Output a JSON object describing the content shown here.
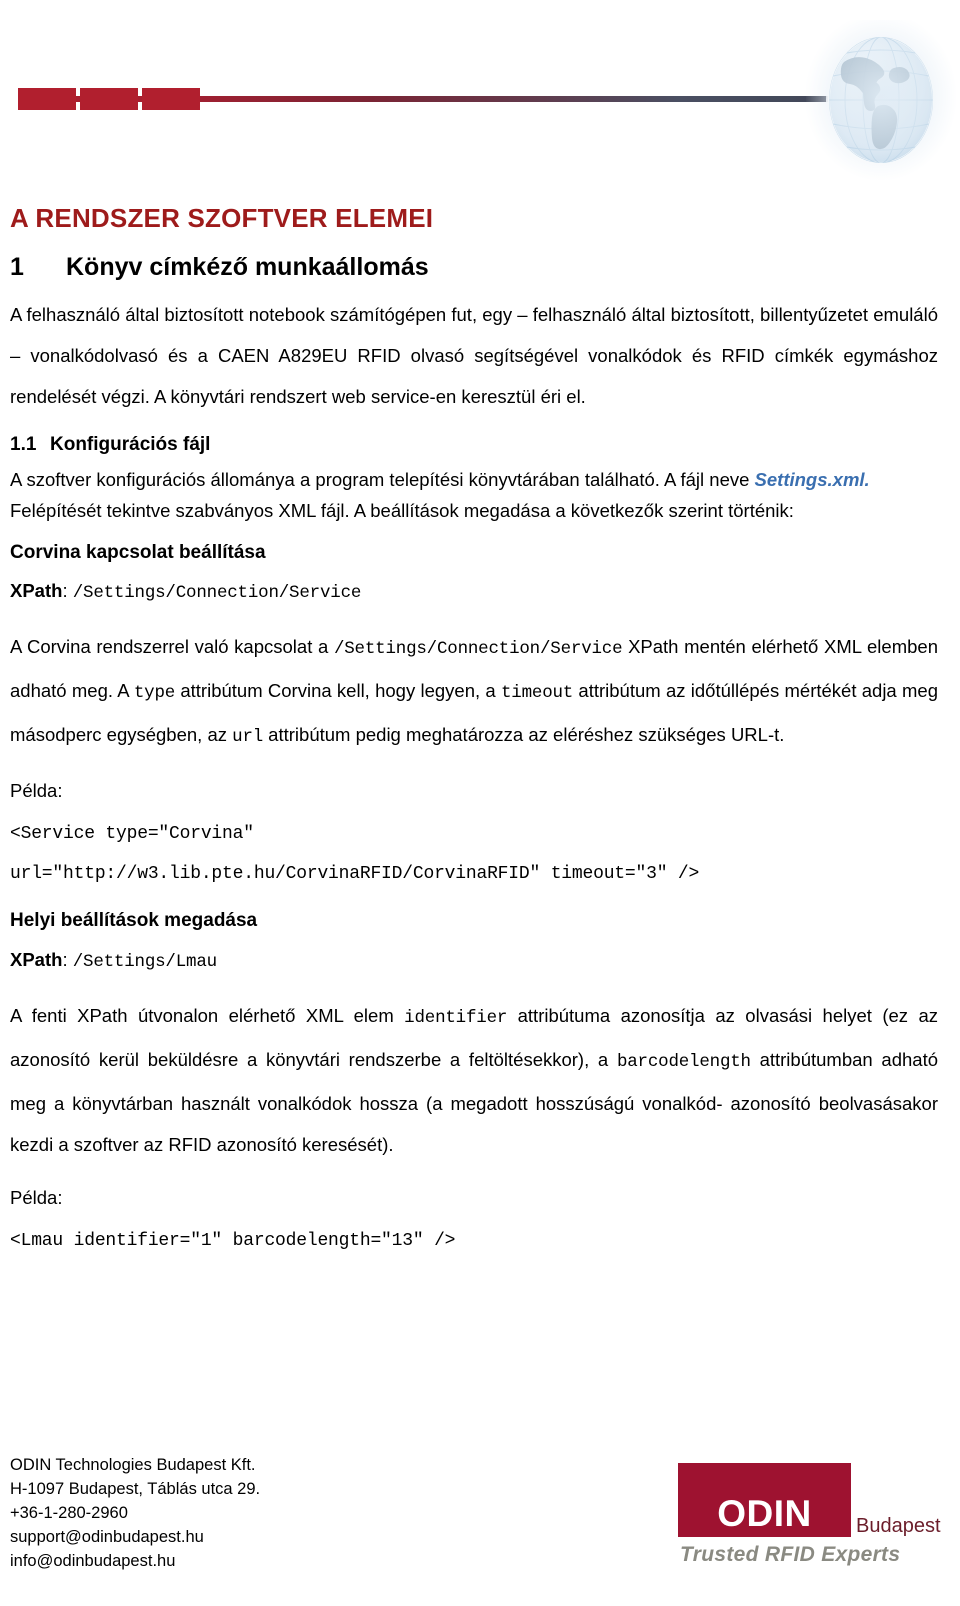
{
  "header": {
    "decor": {
      "bar_color": "#b11f2e",
      "rule_gradient_from": "#a81f30",
      "rule_gradient_to": "#3d4352"
    },
    "globe_alt": "globe-logo"
  },
  "document": {
    "title": "A RENDSZER SZOFTVER ELEMEI",
    "title_color": "#9e1b1b",
    "sections": [
      {
        "number": "1",
        "heading": "Könyv címkéző munkaállomás",
        "paragraph": "A felhasználó által biztosított notebook számítógépen fut, egy – felhasználó által biztosított, billentyűzetet emuláló – vonalkódolvasó és a CAEN A829EU RFID olvasó segítségével vonalkódok és RFID címkék egymáshoz rendelését végzi. A könyvtári rendszert web service-en keresztül éri el."
      }
    ],
    "subsection": {
      "number": "1.1",
      "heading": "Konfigurációs fájl",
      "intro_part1": "A szoftver konfigurációs állománya a program telepítési könyvtárában található. A fájl neve ",
      "intro_filename": "Settings.xml.",
      "intro_filename_color": "#3a6fb0",
      "intro_part2": " Felépítését tekintve szabványos XML fájl. A beállítások megadása a következők szerint történik:"
    },
    "blocks": [
      {
        "heading": "Corvina kapcsolat beállítása",
        "xpath_label": "XPath",
        "xpath_separator": ": ",
        "xpath_value": "/Settings/Connection/Service",
        "body_1": "A Corvina rendszerrel való kapcsolat a ",
        "body_code_1": "/Settings/Connection/Service",
        "body_2": " XPath mentén elérhető XML elemben adható meg. A ",
        "body_code_2": "type",
        "body_3": " attribútum Corvina kell, hogy legyen, a ",
        "body_code_3": "timeout",
        "body_4": " attribútum az időtúllépés mértékét adja meg másodperc egységben, az ",
        "body_code_4": "url",
        "body_5": " attribútum pedig meghatározza az eléréshez szükséges URL-t.",
        "example_label": "Példa:",
        "example_line_1": "<Service type=\"Corvina\"",
        "example_line_2": "url=\"http://w3.lib.pte.hu/CorvinaRFID/CorvinaRFID\" timeout=\"3\" />"
      },
      {
        "heading": "Helyi beállítások megadása",
        "xpath_label": "XPath",
        "xpath_separator": ": ",
        "xpath_value": "/Settings/Lmau",
        "body_1": "A fenti XPath útvonalon elérhető XML elem ",
        "body_code_1": "identifier",
        "body_2": " attribútuma azonosítja az olvasási helyet (ez az azonosító kerül beküldésre a könyvtári rendszerbe a feltöltésekkor), a ",
        "body_code_2": "barcodelength",
        "body_3": " attribútumban adható meg a könyvtárban használt vonalkódok hossza (a megadott hosszúságú vonalkód- azonosító beolvasásakor kezdi a szoftver az RFID azonosító keresését).",
        "example_label": "Példa:",
        "example_line_1": "<Lmau identifier=\"1\" barcodelength=\"13\" />"
      }
    ]
  },
  "footer": {
    "contact": [
      "ODIN Technologies Budapest Kft.",
      "H-1097 Budapest, Táblás utca 29.",
      "+36-1-280-2960",
      "support@odinbudapest.hu",
      "info@odinbudapest.hu"
    ],
    "logo": {
      "wordmark": "ODIN",
      "city": "Budapest",
      "tagline": "Trusted  RFID Experts",
      "box_color": "#9e1230",
      "city_color": "#6b1d2a",
      "tagline_color": "#8a8a82"
    }
  }
}
